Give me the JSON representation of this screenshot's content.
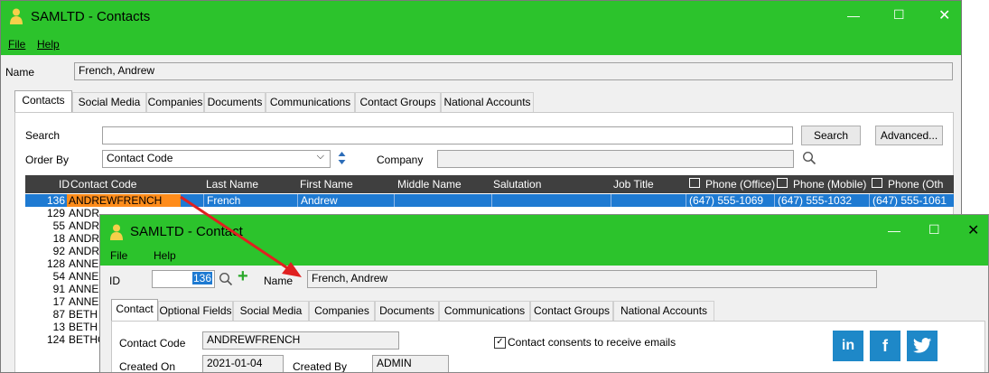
{
  "main": {
    "title": "SAMLTD - Contacts",
    "menu": [
      "File",
      "Help"
    ],
    "name_label": "Name",
    "name_value": "French, Andrew",
    "tabs": [
      "Contacts",
      "Social Media",
      "Companies",
      "Documents",
      "Communications",
      "Contact Groups",
      "National Accounts"
    ],
    "search_label": "Search",
    "search_value": "",
    "search_button": "Search",
    "advanced_button": "Advanced...",
    "order_by_label": "Order By",
    "order_by_value": "Contact Code",
    "company_label": "Company",
    "company_value": "",
    "columns": [
      "ID",
      "Contact Code",
      "Last Name",
      "First Name",
      "Middle Name",
      "Salutation",
      "Job Title",
      "Phone (Office)",
      "Phone (Mobile)",
      "Phone (Oth"
    ],
    "rows": [
      {
        "id": "136",
        "code": "ANDREWFRENCH",
        "last": "French",
        "first": "Andrew",
        "office": "(647) 555-1069",
        "mobile": "(647) 555-1032",
        "other": "(647) 555-1061"
      },
      {
        "id": "129",
        "code": "ANDR"
      },
      {
        "id": "55",
        "code": "ANDR"
      },
      {
        "id": "18",
        "code": "ANDR"
      },
      {
        "id": "92",
        "code": "ANDR"
      },
      {
        "id": "128",
        "code": "ANNE"
      },
      {
        "id": "54",
        "code": "ANNE"
      },
      {
        "id": "91",
        "code": "ANNE"
      },
      {
        "id": "17",
        "code": "ANNE"
      },
      {
        "id": "87",
        "code": "BETH"
      },
      {
        "id": "13",
        "code": "BETH"
      },
      {
        "id": "124",
        "code": "BETHO"
      }
    ]
  },
  "detail": {
    "title": "SAMLTD - Contact",
    "menu": [
      "File",
      "Help"
    ],
    "id_label": "ID",
    "id_value": "136",
    "name_label": "Name",
    "name_value": "French, Andrew",
    "tabs": [
      "Contact",
      "Optional Fields",
      "Social Media",
      "Companies",
      "Documents",
      "Communications",
      "Contact Groups",
      "National Accounts"
    ],
    "contact_code_label": "Contact Code",
    "contact_code_value": "ANDREWFRENCH",
    "created_on_label": "Created On",
    "created_on_value": "2021-01-04",
    "created_by_label": "Created By",
    "created_by_value": "ADMIN",
    "consent_label": "Contact consents to receive emails",
    "consent_checked": true
  },
  "colors": {
    "titlebar": "#2cc32c",
    "selection": "#1e7ad2",
    "highlight": "#ff8c1a",
    "arrow": "#e02020",
    "social": "#1e88c8"
  },
  "icons": [
    "person-icon",
    "minimize-icon",
    "maximize-icon",
    "close-icon",
    "sort-arrows-icon",
    "search-icon",
    "add-icon",
    "linkedin-icon",
    "facebook-icon",
    "twitter-icon"
  ]
}
